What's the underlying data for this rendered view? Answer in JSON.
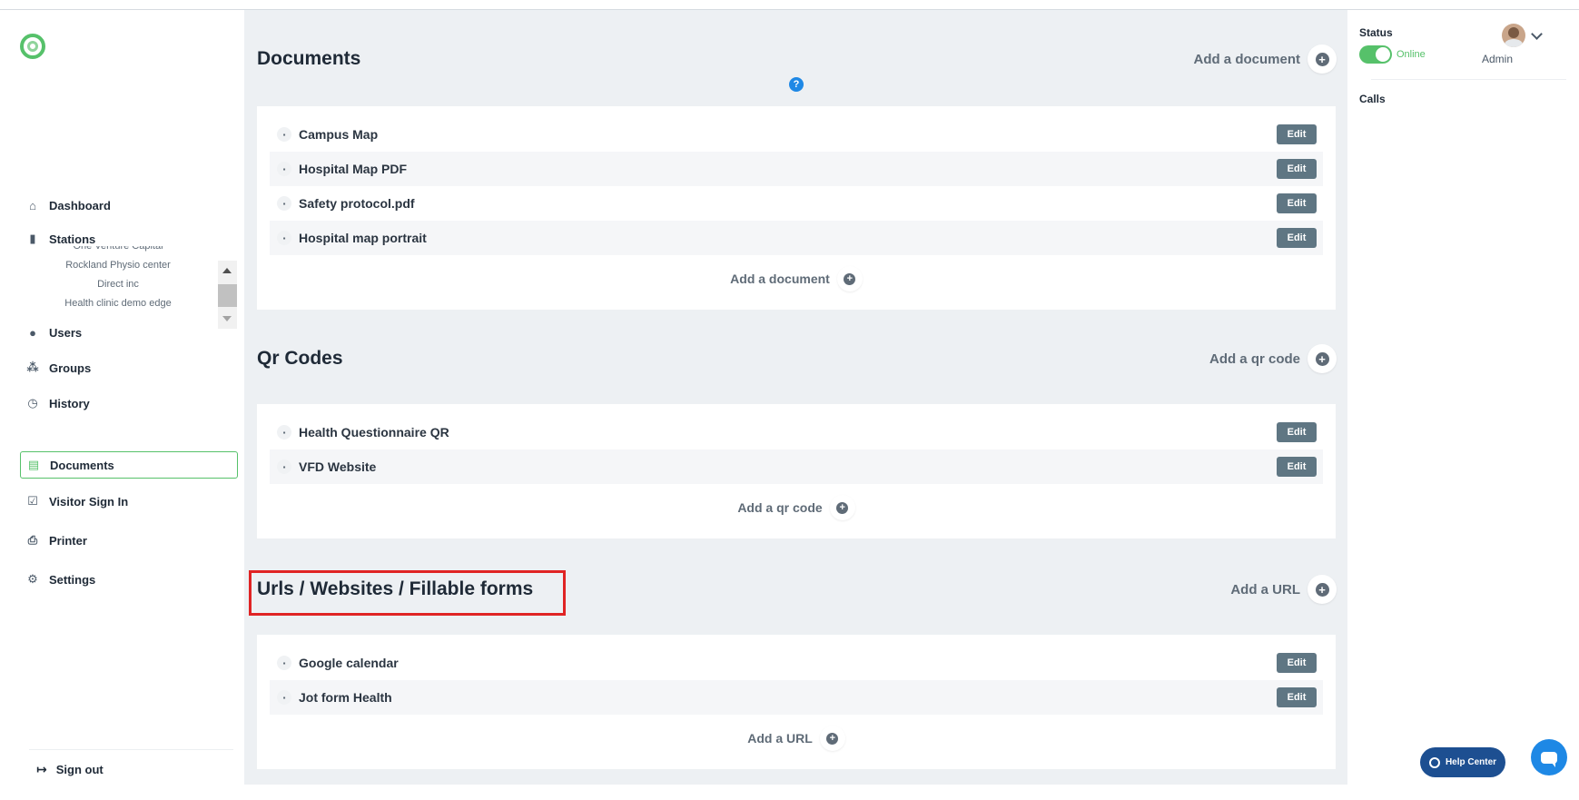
{
  "sidebar": {
    "items": [
      {
        "label": "Dashboard",
        "icon": "home-icon"
      },
      {
        "label": "Stations",
        "icon": "station-icon"
      },
      {
        "label": "Users",
        "icon": "user-icon"
      },
      {
        "label": "Groups",
        "icon": "groups-icon"
      },
      {
        "label": "History",
        "icon": "clock-icon"
      },
      {
        "label": "Documents",
        "icon": "document-icon"
      },
      {
        "label": "Visitor Sign In",
        "icon": "clipboard-icon"
      },
      {
        "label": "Printer",
        "icon": "printer-icon"
      },
      {
        "label": "Settings",
        "icon": "gear-icon"
      }
    ],
    "stations": [
      "One Venture Capital",
      "Rockland Physio center",
      "Direct inc",
      "Health clinic demo edge"
    ],
    "sign_out": "Sign out",
    "accent_color": "#56c16a"
  },
  "main": {
    "documents": {
      "title": "Documents",
      "add_label": "Add a document",
      "items": [
        "Campus Map",
        "Hospital Map PDF",
        "Safety protocol.pdf",
        "Hospital map portrait"
      ],
      "edit_label": "Edit"
    },
    "qr_codes": {
      "title": "Qr Codes",
      "add_label": "Add a qr code",
      "items": [
        "Health Questionnaire QR",
        "VFD Website"
      ],
      "edit_label": "Edit"
    },
    "urls": {
      "title": "Urls / Websites / Fillable forms",
      "add_label": "Add a URL",
      "items": [
        "Google calendar",
        "Jot form Health"
      ],
      "edit_label": "Edit"
    },
    "help_glyph": "?",
    "plus_glyph": "+"
  },
  "right_panel": {
    "status_label": "Status",
    "status_value": "Online",
    "user_role": "Admin",
    "calls_label": "Calls",
    "help_center_label": "Help Center"
  }
}
